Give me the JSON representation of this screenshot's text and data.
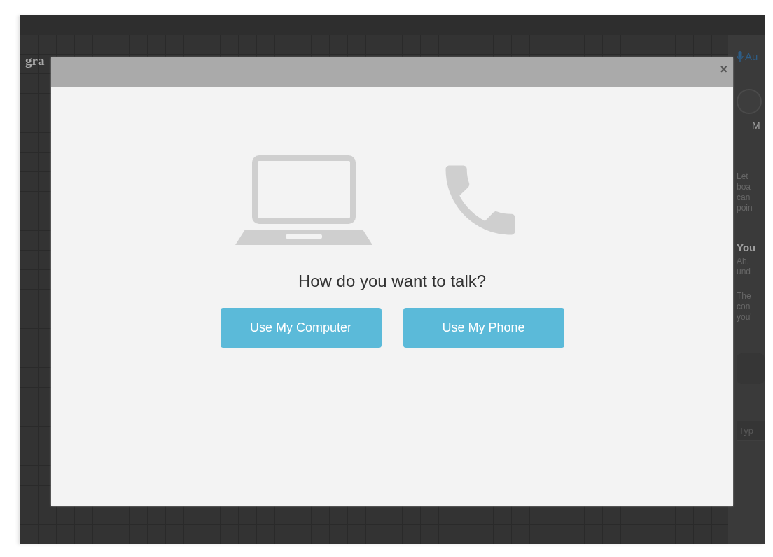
{
  "app": {
    "title": "gra"
  },
  "sidebar": {
    "audio_label": "Au",
    "user_name": "M",
    "messages": [
      {
        "kind": "text",
        "lines": [
          "Let",
          "boa",
          "can",
          "poin"
        ]
      },
      {
        "kind": "reply",
        "author": "You",
        "lines": [
          "Ah,",
          "und"
        ]
      },
      {
        "kind": "text",
        "lines": [
          "The",
          "con",
          "you'"
        ]
      }
    ],
    "input": {
      "placeholder": "Typ"
    }
  },
  "dialog": {
    "close": "×",
    "question": "How do you want to talk?",
    "buttons": [
      "Use My Computer",
      "Use My Phone"
    ]
  }
}
